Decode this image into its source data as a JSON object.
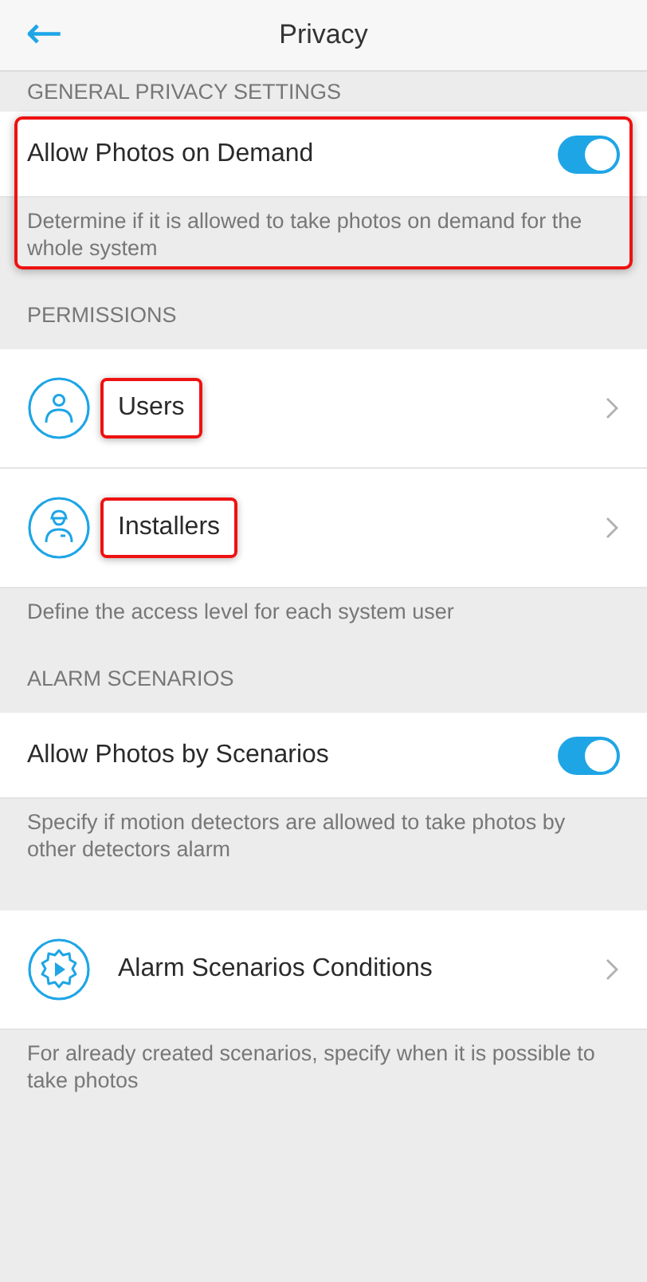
{
  "header": {
    "back_icon": "←",
    "title": "Privacy"
  },
  "sections": [
    {
      "title": "GENERAL PRIVACY SETTINGS",
      "highlighted": true,
      "items": [
        {
          "kind": "toggle",
          "label": "Allow Photos on Demand",
          "on": true
        }
      ],
      "note": "Determine if it is allowed to take photos on demand for the whole system"
    },
    {
      "title": "PERMISSIONS",
      "highlighted": false,
      "items": [
        {
          "kind": "person-link",
          "label": "Users",
          "highlighted": true
        },
        {
          "kind": "installer-link",
          "label": "Installers",
          "highlighted": true
        }
      ],
      "note": "Define the access level for each system user"
    },
    {
      "title": "ALARM SCENARIOS",
      "highlighted": false,
      "items": [
        {
          "kind": "toggle",
          "label": "Allow Photos by Scenarios",
          "on": true
        }
      ],
      "note": "Specify if motion detectors are allowed to take photos by other detectors alarm"
    },
    {
      "highlighted": false,
      "items": [
        {
          "kind": "scenario-link",
          "label": "Alarm Scenarios Conditions",
          "highlighted": false
        }
      ],
      "note": "For already created scenarios, specify when it is possible to take photos"
    }
  ]
}
